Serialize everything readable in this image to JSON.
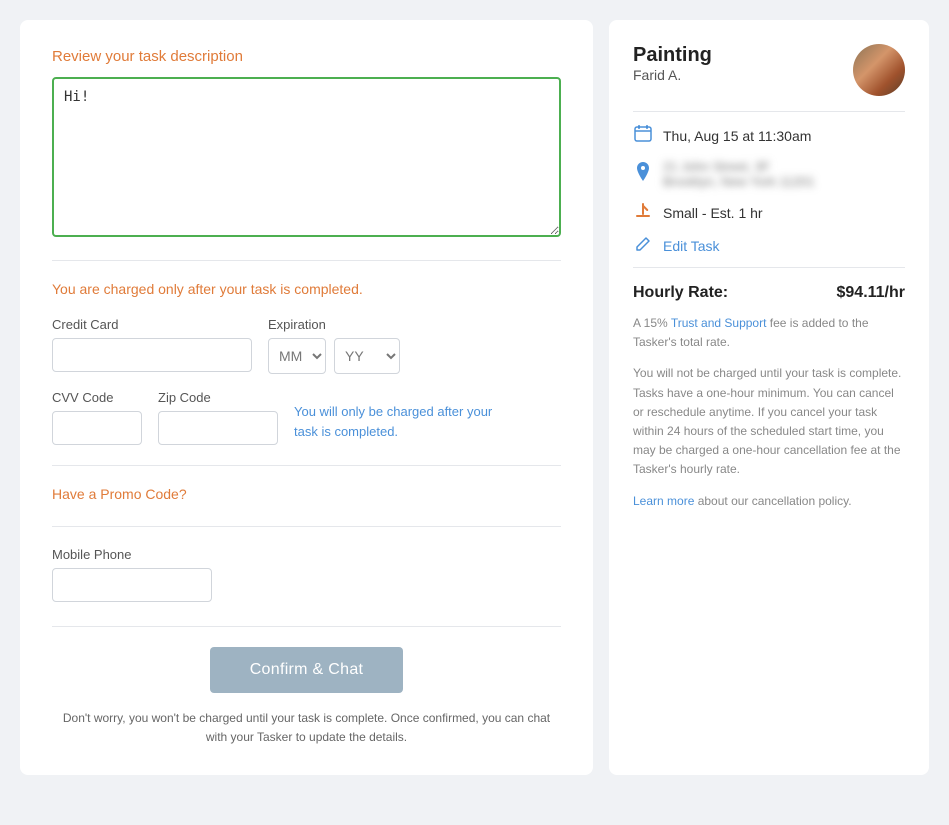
{
  "left": {
    "task_label": "Review your task description",
    "task_text": "Hi!",
    "charge_notice": "You are charged only after your task is completed.",
    "credit_card_label": "Credit Card",
    "credit_card_placeholder": "",
    "expiration_label": "Expiration",
    "month_placeholder": "MM",
    "year_placeholder": "YY",
    "cvv_label": "CVV Code",
    "cvv_placeholder": "",
    "zip_label": "Zip Code",
    "zip_placeholder": "",
    "charge_note": "You will only be charged after your task is completed.",
    "promo_label": "Have a Promo Code?",
    "phone_label": "Mobile Phone",
    "phone_placeholder": "",
    "confirm_btn": "Confirm & Chat",
    "footnote": "Don't worry, you won't be charged until your task is complete. Once confirmed, you can chat with your Tasker to update the details."
  },
  "right": {
    "task_title": "Painting",
    "tasker_name": "Farid A.",
    "date_time": "Thu, Aug 15 at 11:30am",
    "address_blurred": "21 John Street, 3F\nBrooklyn, New York 11201",
    "task_size": "Small - Est. 1 hr",
    "edit_label": "Edit Task",
    "hourly_rate_label": "Hourly Rate:",
    "hourly_rate_value": "$94.11/hr",
    "fee_notice": "A 15% Trust and Support fee is added to the Tasker's total rate.",
    "fee_notice_link": "Trust and Support",
    "policy_notice": "You will not be charged until your task is complete. Tasks have a one-hour minimum. You can cancel or reschedule anytime. If you cancel your task within 24 hours of the scheduled start time, you may be charged a one-hour cancellation fee at the Tasker's hourly rate.",
    "learn_more_text": "Learn more",
    "learn_more_suffix": " about our cancellation policy.",
    "icons": {
      "calendar": "📅",
      "location": "📍",
      "task_size": "🖌",
      "edit": "✏️"
    }
  }
}
